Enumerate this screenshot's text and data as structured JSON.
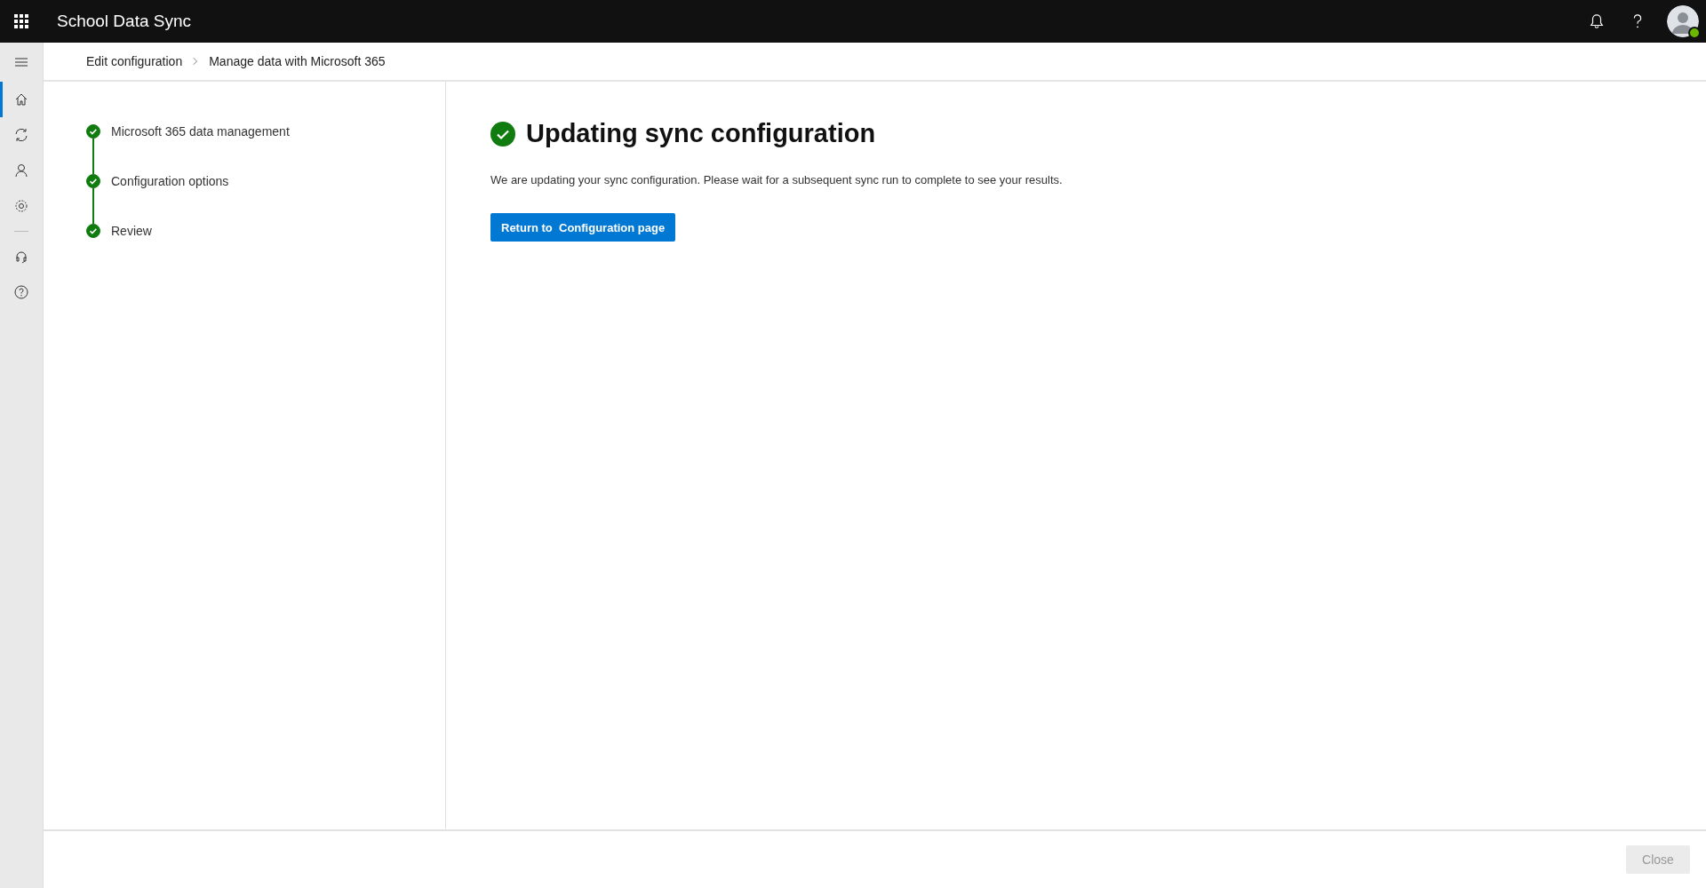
{
  "app_bar": {
    "title": "School Data Sync",
    "avatar": {
      "online": true
    }
  },
  "nav_rail": {
    "items": [
      {
        "kind": "home",
        "selected": true
      },
      {
        "kind": "sync",
        "selected": false
      },
      {
        "kind": "person",
        "selected": false
      },
      {
        "kind": "gear",
        "selected": false
      },
      {
        "kind": "headset",
        "selected": false
      },
      {
        "kind": "help",
        "selected": false
      }
    ]
  },
  "breadcrumb": [
    "Edit configuration",
    "Manage data with Microsoft 365"
  ],
  "steps": [
    {
      "label": "Microsoft 365 data management",
      "completed": true
    },
    {
      "label": "Configuration options",
      "completed": true
    },
    {
      "label": "Review",
      "completed": true
    }
  ],
  "content": {
    "title": "Updating sync configuration",
    "success": true,
    "message": "We are updating your sync configuration. Please wait for a subsequent sync run to complete to see your results.",
    "button": "Return to  Configuration page"
  },
  "footer": {
    "close_button": {
      "label": "Close",
      "disabled": true
    }
  }
}
